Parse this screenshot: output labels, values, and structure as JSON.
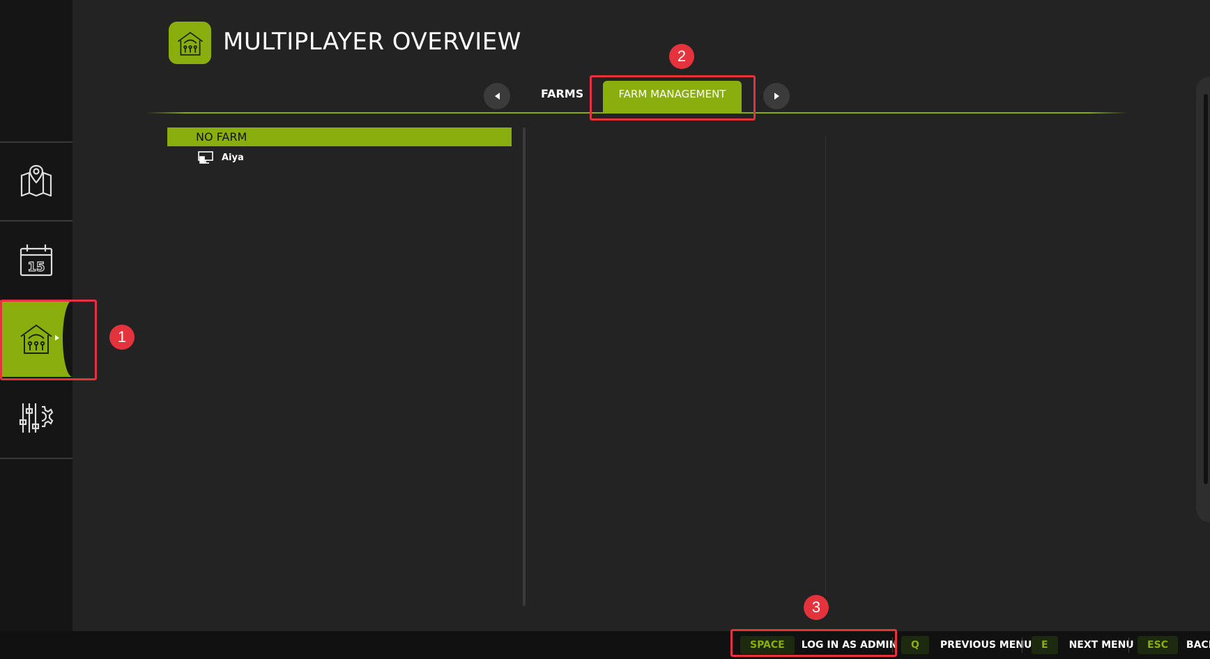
{
  "header": {
    "title": "MULTIPLAYER OVERVIEW",
    "icon": "barn-icon"
  },
  "sidebar": {
    "items": [
      {
        "icon": "map-icon",
        "active": false
      },
      {
        "icon": "calendar-icon",
        "active": false,
        "day": "15"
      },
      {
        "icon": "barn-icon",
        "active": true
      },
      {
        "icon": "settings-sliders-icon",
        "active": false
      }
    ]
  },
  "tabs": [
    {
      "label": "FARMS",
      "active": false
    },
    {
      "label": "FARM MANAGEMENT",
      "active": true
    }
  ],
  "farm_list": {
    "group": "NO FARM",
    "players": [
      {
        "name": "Aiya",
        "icon": "pc-player-icon"
      }
    ]
  },
  "bottom_bar": {
    "actions": [
      {
        "key": "SPACE",
        "label": "LOG IN AS ADMIN"
      },
      {
        "key": "Q",
        "label": "PREVIOUS MENU"
      },
      {
        "key": "E",
        "label": "NEXT MENU"
      },
      {
        "key": "ESC",
        "label": "BACK"
      }
    ]
  },
  "annotations": [
    {
      "label": "1"
    },
    {
      "label": "2"
    },
    {
      "label": "3"
    }
  ],
  "colors": {
    "accent": "#8aae0e",
    "background": "#232323",
    "sidebar": "#151515",
    "annotation": "#e5333d"
  }
}
